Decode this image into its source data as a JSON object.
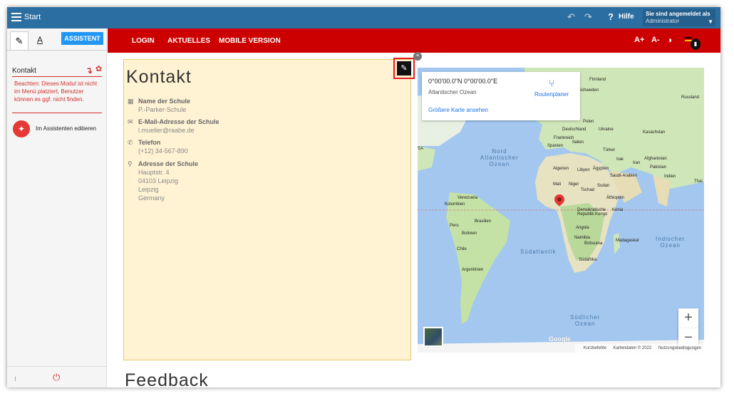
{
  "topbar": {
    "title": "Start",
    "help_label": "Hilfe",
    "help_glyph": "?",
    "user_line1": "Sie sind angemeldet als",
    "user_line2": "Administrator"
  },
  "left_panel": {
    "tab_text_label": "A",
    "assistant_label": "ASSISTENT",
    "module_name": "Kontakt",
    "warning": "Beachten: Dieses Modul ist nicht im Menü platziert, Benutzer können es ggf. nicht finden.",
    "assistant_edit_label": "Im Assistenten editieren"
  },
  "nav": {
    "items": [
      "LOGIN",
      "AKTUELLES",
      "MOBILE VERSION"
    ],
    "font_up": "A+",
    "font_down": "A-"
  },
  "contact": {
    "title": "Kontakt",
    "school_label": "Name der Schule",
    "school_value": "P.-Parker-Schule",
    "email_label": "E-Mail-Adresse der Schule",
    "email_value": "l.mueller@raabe.de",
    "phone_label": "Telefon",
    "phone_value": "(+12) 34-567-890",
    "address_label": "Adresse der Schule",
    "address_lines": [
      "Hauptstr. 4",
      "04103 Leipzig",
      "Leipzig",
      "Germany"
    ]
  },
  "map": {
    "coords": "0°00'00.0\"N 0°00'00.0\"E",
    "ocean_name": "Atlantischer Ozean",
    "route_label": "Routenplaner",
    "bigger_map": "Größere Karte ansehen",
    "seas": {
      "north_atlantic": "Nord\nAtlantischer\nOzean",
      "south_atlantic": "Südatlantik",
      "indian": "Indischer\nOzean",
      "southern": "Südlicher\nOzean"
    },
    "places": {
      "finnland": "Finnland",
      "schweden": "Schweden",
      "russland": "Russland",
      "polen": "Polen",
      "deutschland": "Deutschland",
      "ukraine": "Ukraine",
      "frankreich": "Frankreich",
      "kasachstan": "Kasachstan",
      "spanien": "Spanien",
      "italien": "Italien",
      "tuerkei": "Türkei",
      "irak": "Irak",
      "iran": "Iran",
      "afghanistan": "Afghanistan",
      "pakistan": "Pakistan",
      "algerien": "Algerien",
      "libyen": "Libyen",
      "aegypten": "Ägypten",
      "saudi": "Saudi-Arabien",
      "indien": "Indien",
      "thai": "Thai",
      "mali": "Mali",
      "niger": "Niger",
      "sudan": "Sudan",
      "tschad": "Tschad",
      "aethiopien": "Äthiopien",
      "kongo": "Demokratische Republik Kongo",
      "kenia": "Kenia",
      "venezuela": "Venezuela",
      "kolumbien": "Kolumbien",
      "peru": "Peru",
      "brasilien": "Brasilien",
      "bolivien": "Bolivien",
      "chile": "Chile",
      "argentinien": "Argentinien",
      "angola": "Angola",
      "namibia": "Namibia",
      "botsuana": "Botsuana",
      "madagaskar": "Madagaskar",
      "suedafrika": "Südafrika",
      "sa": "SA"
    },
    "google": "Google",
    "footer": [
      "Kurzbefehle",
      "Kartendaten © 2022",
      "Nutzungsbedingungen"
    ],
    "zoom_in": "+",
    "zoom_out": "−"
  },
  "feedback_title": "Feedback",
  "colors": {
    "topbar": "#2b6ea1",
    "nav": "#cc0000",
    "contact_bg": "#fff3d4",
    "accent_blue": "#2196f3",
    "warning_red": "#d32f2f"
  }
}
